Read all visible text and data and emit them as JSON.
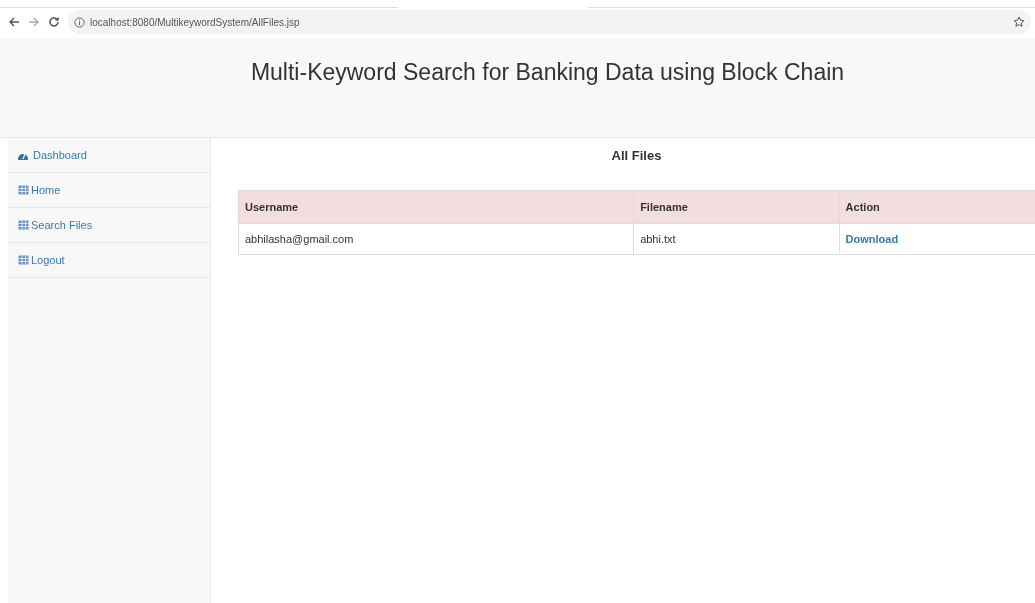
{
  "browser": {
    "url": "localhost:8080/MultikeywordSystem/AllFiles.jsp"
  },
  "header": {
    "title": "Multi-Keyword Search for Banking Data using Block Chain"
  },
  "sidebar": {
    "items": [
      {
        "label": "Dashboard",
        "kind": "dashboard"
      },
      {
        "label": "Home",
        "kind": "table"
      },
      {
        "label": "Search Files",
        "kind": "table"
      },
      {
        "label": "Logout",
        "kind": "table"
      }
    ]
  },
  "content": {
    "heading": "All Files",
    "table": {
      "columns": [
        "Username",
        "Filename",
        "Action"
      ],
      "rows": [
        {
          "username": "abhilasha@gmail.com",
          "filename": "abhi.txt",
          "action": "Download"
        }
      ]
    }
  }
}
